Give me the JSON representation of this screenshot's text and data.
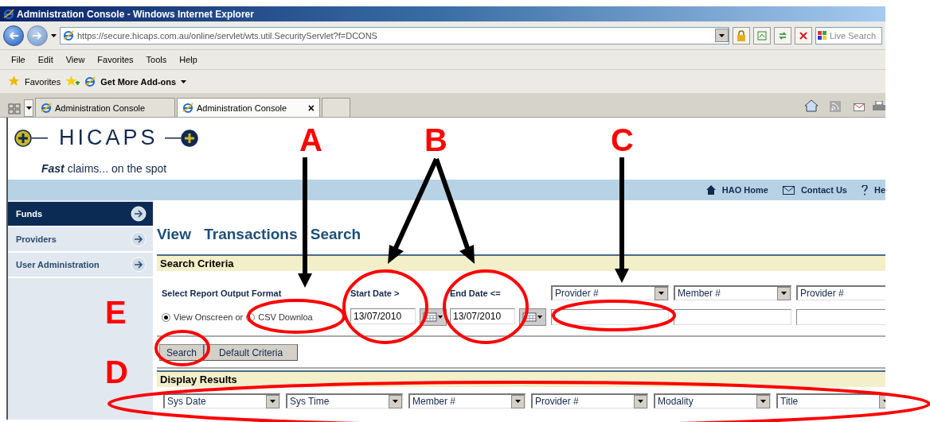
{
  "window": {
    "title": "Administration Console - Windows Internet Explorer"
  },
  "browser": {
    "address": "https://secure.hicaps.com.au/online/servlet/wts.util.SecurityServlet?f=DCONS",
    "search_placeholder": "Live Search",
    "menu": [
      "File",
      "Edit",
      "View",
      "Favorites",
      "Tools",
      "Help"
    ],
    "favorites": {
      "label": "Favorites",
      "addons": "Get More Add-ons"
    },
    "tabs": [
      {
        "label": "Administration Console",
        "selected": false
      },
      {
        "label": "Administration Console",
        "selected": true,
        "close": "×"
      }
    ]
  },
  "page": {
    "logo": "HICAPS",
    "tagline": "**Fast** claims... on the spot",
    "nav_links": [
      {
        "kind": "home",
        "label": "HAO Home"
      },
      {
        "kind": "mail",
        "label": "Contact Us"
      },
      {
        "kind": "help",
        "label": "He"
      }
    ],
    "sidebar": [
      {
        "label": "Funds",
        "selected": true
      },
      {
        "label": "Providers",
        "selected": false
      },
      {
        "label": "User Administration",
        "selected": false
      }
    ],
    "heading": "View Transactions Search",
    "search_criteria": {
      "title": "Search Criteria",
      "format_label": "Select Report Output Format",
      "formats": [
        {
          "label": "View Onscreen or",
          "selected": true
        },
        {
          "label": "CSV Downloa",
          "selected": false
        }
      ],
      "start_date": {
        "label": "Start Date >",
        "value": "13/07/2010"
      },
      "end_date": {
        "label": "End Date <=",
        "value": "13/07/2010"
      },
      "filters": [
        {
          "field": "Provider #"
        },
        {
          "field": "Member #"
        },
        {
          "field": "Provider #"
        }
      ],
      "buttons": [
        "Search",
        "Default Criteria"
      ]
    },
    "display_results": {
      "title": "Display Results",
      "columns": [
        "Sys Date",
        "Sys Time",
        "Member #",
        "Provider #",
        "Modality",
        "Title"
      ]
    }
  },
  "annotations": [
    {
      "label": "A"
    },
    {
      "label": "B"
    },
    {
      "label": "C"
    },
    {
      "label": "D"
    },
    {
      "label": "E"
    }
  ]
}
